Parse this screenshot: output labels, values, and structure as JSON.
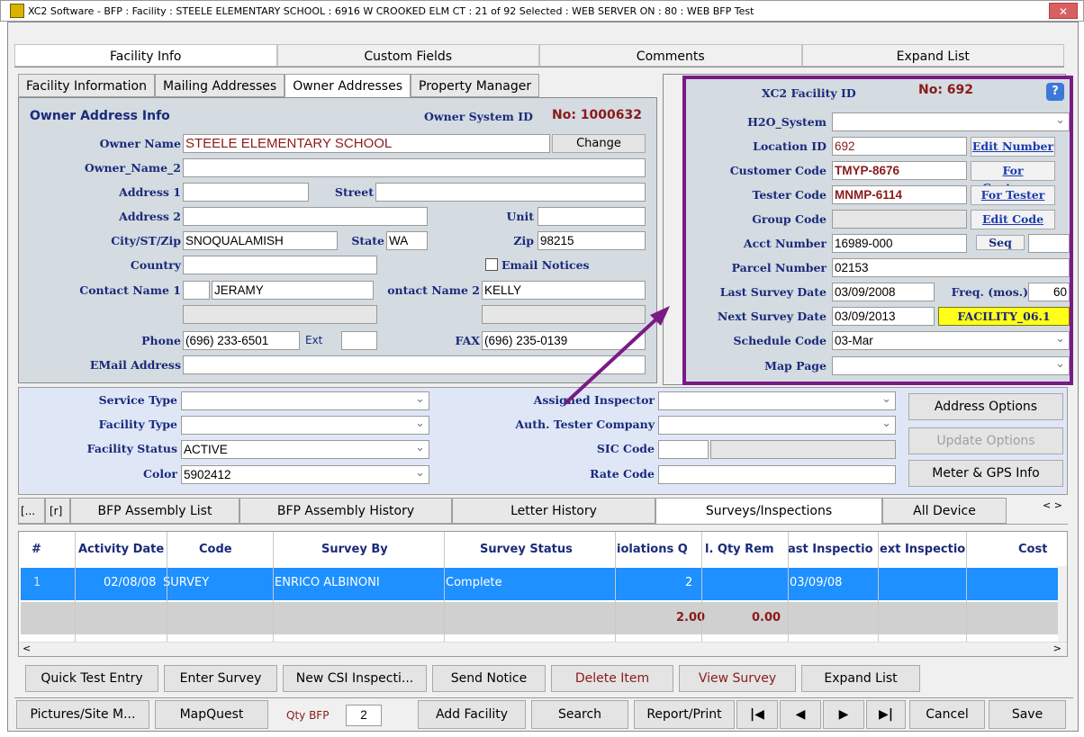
{
  "window": {
    "title": "XC2 Software - BFP : Facility : STEELE ELEMENTARY SCHOOL : 6916 W CROOKED ELM CT : 21 of 92 Selected : WEB SERVER ON : 80 : WEB BFP Test",
    "close": "✕"
  },
  "top_tabs": [
    "Facility Info",
    "Custom Fields",
    "Comments",
    "Expand List"
  ],
  "inner_tabs": [
    "Facility Information",
    "Mailing Addresses",
    "Owner Addresses",
    "Property Manager"
  ],
  "owner": {
    "section_title": "Owner Address Info",
    "system_id_label": "Owner System ID",
    "system_id_value": "No: 1000632",
    "owner_name_label": "Owner Name",
    "owner_name": "STEELE ELEMENTARY SCHOOL",
    "change_button": "Change",
    "owner_name2_label": "Owner_Name_2",
    "owner_name2": "",
    "address1_label": "Address 1",
    "street_label": "Street",
    "address2_label": "Address 2",
    "unit_label": "Unit",
    "city_label": "City/ST/Zip",
    "city": "SNOQUALAMISH",
    "state_label": "State",
    "state": "WA",
    "zip_label": "Zip",
    "zip": "98215",
    "country_label": "Country",
    "email_notices_label": "Email Notices",
    "contact1_label": "Contact Name 1",
    "contact1": "JERAMY",
    "contact2_label": "ontact Name 2",
    "contact2": "KELLY",
    "phone_label": "Phone",
    "phone": "(696) 233-6501",
    "ext_label": "Ext",
    "fax_label": "FAX",
    "fax": "(696) 235-0139",
    "email_label": "EMail Address"
  },
  "facility_id": {
    "title": "XC2 Facility ID",
    "number": "No: 692",
    "help": "?",
    "h2o_label": "H2O_System",
    "location_label": "Location ID",
    "location": "692",
    "edit_number": "Edit Number",
    "customer_label": "Customer Code",
    "customer": "TMYP-8676",
    "for_customer": "For Customer",
    "tester_label": "Tester Code",
    "tester": "MNMP-6114",
    "for_tester": "For Tester",
    "group_label": "Group Code",
    "edit_code": "Edit Code",
    "acct_label": "Acct Number",
    "acct": "16989-000",
    "seq_label": "Seq",
    "parcel_label": "Parcel Number",
    "parcel": "02153",
    "last_survey_label": "Last Survey Date",
    "last_survey": "03/09/2008",
    "freq_label": "Freq. (mos.)",
    "freq": "60",
    "next_survey_label": "Next Survey Date",
    "next_survey": "03/09/2013",
    "facility_badge": "FACILITY_06.1",
    "schedule_label": "Schedule Code",
    "schedule": "03-Mar",
    "map_label": "Map Page"
  },
  "service": {
    "service_type_label": "Service Type",
    "facility_type_label": "Facility Type",
    "facility_status_label": "Facility Status",
    "facility_status": "ACTIVE",
    "color_label": "Color",
    "color": "5902412",
    "assigned_label": "Assigned Inspector",
    "auth_label": "Auth. Tester Company",
    "sic_label": "SIC Code",
    "rate_label": "Rate Code",
    "address_options": "Address Options",
    "update_options": "Update Options",
    "meter_gps": "Meter & GPS Info"
  },
  "bottom_tabs": [
    "[...",
    "[r]",
    "BFP Assembly List",
    "BFP Assembly History",
    "Letter History",
    "Surveys/Inspections",
    "All Device"
  ],
  "grid": {
    "headers": [
      "#",
      "Activity Date",
      "Code",
      "Survey By",
      "Survey Status",
      "iolations Q",
      "l. Qty Rem",
      "ast Inspectio",
      "ext Inspectio",
      "Cost"
    ],
    "row": [
      "1",
      "02/08/08",
      "SURVEY",
      "ENRICO ALBINONI",
      "Complete",
      "2",
      "",
      "03/09/08",
      "",
      ""
    ],
    "totals": [
      "2.00",
      "0.00"
    ]
  },
  "action_buttons": [
    "Quick Test Entry",
    "Enter Survey",
    "New CSI Inspecti...",
    "Send Notice",
    "Delete Item",
    "View Survey",
    "Expand List"
  ],
  "footer": {
    "pictures": "Pictures/Site M...",
    "mapquest": "MapQuest",
    "qty_label": "Qty BFP",
    "qty_value": "2",
    "add_facility": "Add Facility",
    "search": "Search",
    "report": "Report/Print",
    "cancel": "Cancel",
    "save": "Save"
  },
  "colors": {
    "accent_purple": "#7a1a86",
    "selection_blue": "#1e90ff",
    "panel_bg": "#d4dbe1",
    "lower_panel_bg": "#dfe7f7",
    "maroon": "#8b1a1a"
  }
}
